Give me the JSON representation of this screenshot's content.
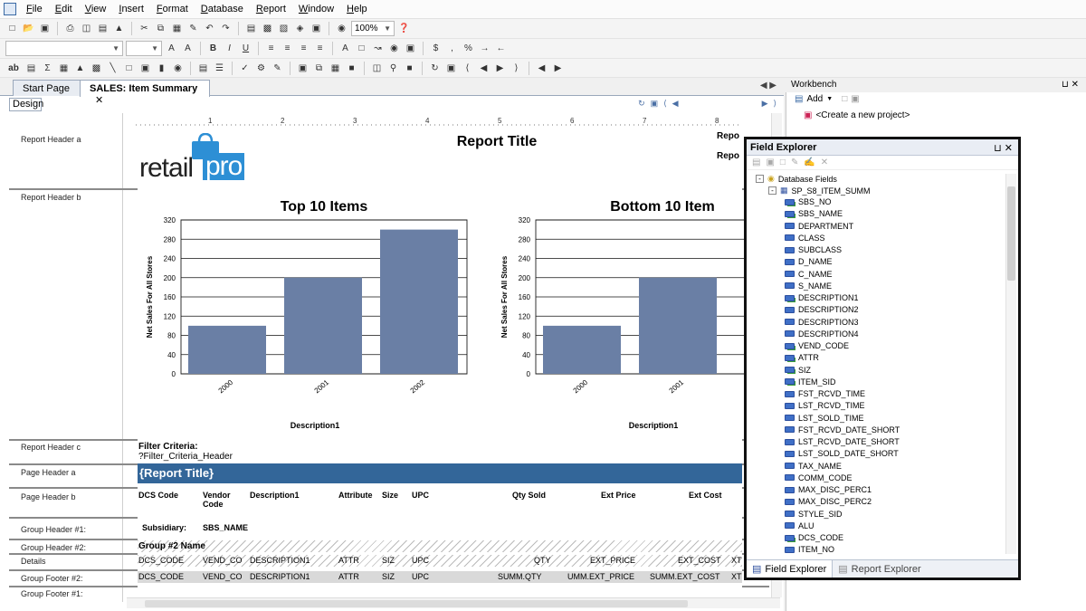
{
  "menubar": {
    "items": [
      "File",
      "Edit",
      "View",
      "Insert",
      "Format",
      "Database",
      "Report",
      "Window",
      "Help"
    ]
  },
  "toolbar1": {
    "zoom": "100%"
  },
  "toolbar2": {
    "font": "",
    "size": "",
    "labels": [
      "B",
      "I",
      "U",
      "$",
      ",",
      "%"
    ]
  },
  "toolbar3": {
    "labels": [
      "ab",
      "Σ"
    ]
  },
  "tabs": [
    {
      "label": "Start Page"
    },
    {
      "label": "SALES: Item Summary"
    }
  ],
  "design_label": "Design",
  "bands": [
    "Report Header a",
    "Report Header b",
    "Report Header c",
    "Page Header a",
    "Page Header b",
    "Group Header #1:",
    "Group Header #2:",
    "Details",
    "Group Footer #2:",
    "Group Footer #1:"
  ],
  "ruler_marks": [
    "1",
    "2",
    "3",
    "4",
    "5",
    "6",
    "7",
    "8"
  ],
  "report": {
    "title": "Report Title",
    "header_right": [
      "Repo",
      "Repo"
    ],
    "logo_text": "retail",
    "logo_text2": "pro",
    "filter_label": "Filter Criteria:",
    "filter_value": "?Filter_Criteria_Header",
    "page_title": "{Report Title}",
    "columns": [
      "DCS Code",
      "Vendor Code",
      "Description1",
      "Attribute",
      "Size",
      "UPC",
      "Qty Sold",
      "Ext Price",
      "Ext Cost"
    ],
    "subsidiary_label": "Subsidiary:",
    "subsidiary_value": "SBS_NAME",
    "group2_label": "Group #2 Name",
    "details_cells": [
      "DCS_CODE",
      "VEND_CO",
      "DESCRIPTION1",
      "ATTR",
      "SIZ",
      "UPC",
      "QTY",
      "EXT_PRICE",
      "EXT_COST",
      "XT"
    ],
    "footer2_cells": [
      "DCS_CODE",
      "VEND_CO",
      "DESCRIPTION1",
      "ATTR",
      "SIZ",
      "UPC",
      "SUMM.QTY",
      "UMM.EXT_PRICE",
      "SUMM.EXT_COST",
      "XT"
    ]
  },
  "chart_data": [
    {
      "type": "bar",
      "title": "Top 10 Items",
      "xlabel": "Description1",
      "ylabel": "Net Sales For All Stores",
      "categories": [
        "2000",
        "2001",
        "2002"
      ],
      "values": [
        100,
        200,
        300
      ],
      "ylim": [
        0,
        320
      ],
      "yticks": [
        0,
        40,
        80,
        120,
        160,
        200,
        240,
        280,
        320
      ],
      "grid": true
    },
    {
      "type": "bar",
      "title": "Bottom 10 Item",
      "xlabel": "Description1",
      "ylabel": "Net Sales For All Stores",
      "categories": [
        "2000",
        "2001"
      ],
      "values": [
        100,
        200
      ],
      "ylim": [
        0,
        320
      ],
      "yticks": [
        0,
        40,
        80,
        120,
        160,
        200,
        240,
        280,
        320
      ],
      "grid": true
    }
  ],
  "workbench": {
    "title": "Workbench",
    "add_label": "Add",
    "create_project": "<Create a new project>"
  },
  "field_explorer": {
    "title": "Field Explorer",
    "root": "Database Fields",
    "table": "SP_S8_ITEM_SUMM",
    "fields": [
      "SBS_NO",
      "SBS_NAME",
      "DEPARTMENT",
      "CLASS",
      "SUBCLASS",
      "D_NAME",
      "C_NAME",
      "S_NAME",
      "DESCRIPTION1",
      "DESCRIPTION2",
      "DESCRIPTION3",
      "DESCRIPTION4",
      "VEND_CODE",
      "ATTR",
      "SIZ",
      "ITEM_SID",
      "FST_RCVD_TIME",
      "LST_RCVD_TIME",
      "LST_SOLD_TIME",
      "FST_RCVD_DATE_SHORT",
      "LST_RCVD_DATE_SHORT",
      "LST_SOLD_DATE_SHORT",
      "TAX_NAME",
      "COMM_CODE",
      "MAX_DISC_PERC1",
      "MAX_DISC_PERC2",
      "STYLE_SID",
      "ALU",
      "DCS_CODE",
      "ITEM_NO"
    ],
    "tabs": [
      "Field Explorer",
      "Report Explorer"
    ]
  },
  "colors": {
    "bar": "#6a7fa5",
    "page_title_bg": "#336699",
    "logo_blue": "#2d8fd5"
  }
}
